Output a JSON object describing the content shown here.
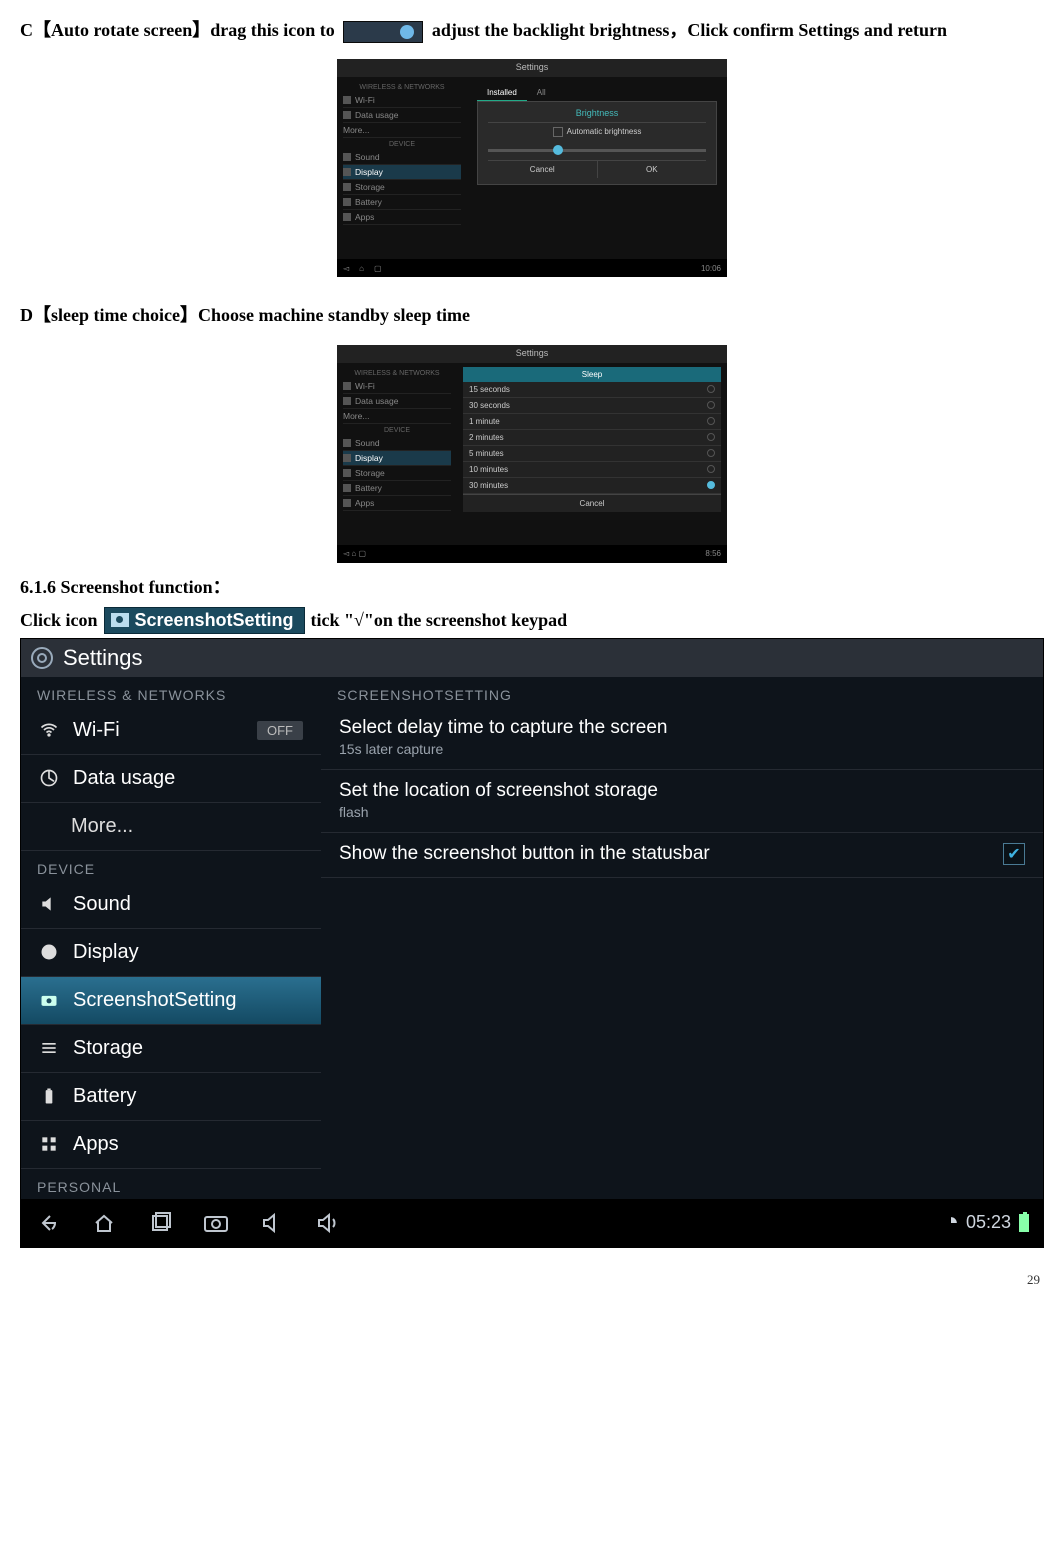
{
  "doc": {
    "line_c_prefix": "C【Auto rotate screen】drag this icon to ",
    "line_c_suffix": "adjust the backlight brightness，Click confirm Settings and return",
    "line_d": "D【sleep time choice】Choose machine standby sleep time",
    "heading_616": "6.1.6 Screenshot function：",
    "clickicon_pre": "Click icon",
    "clickicon_post": " tick \"√\"on the screenshot keypad",
    "page_number": "29"
  },
  "ss_button": {
    "label": "ScreenshotSetting"
  },
  "shot1": {
    "title": "Settings",
    "sect_wireless": "WIRELESS & NETWORKS",
    "sect_device": "DEVICE",
    "side": {
      "wifi": "Wi-Fi",
      "datausage": "Data usage",
      "more": "More...",
      "sound": "Sound",
      "display": "Display",
      "storage": "Storage",
      "battery": "Battery",
      "apps": "Apps"
    },
    "tabs": {
      "installed": "Installed",
      "all": "All"
    },
    "dialog": {
      "title": "Brightness",
      "auto": "Automatic brightness",
      "cancel": "Cancel",
      "ok": "OK"
    },
    "clock": "10:06"
  },
  "shot2": {
    "title": "Settings",
    "sect_wireless": "WIRELESS & NETWORKS",
    "sect_device": "DEVICE",
    "side": {
      "wifi": "Wi-Fi",
      "datausage": "Data usage",
      "more": "More...",
      "sound": "Sound",
      "display": "Display",
      "storage": "Storage",
      "battery": "Battery",
      "apps": "Apps"
    },
    "dialog_title": "Sleep",
    "options": [
      "15 seconds",
      "30 seconds",
      "1 minute",
      "2 minutes",
      "5 minutes",
      "10 minutes",
      "30 minutes"
    ],
    "cancel": "Cancel",
    "clock": "8:56"
  },
  "big": {
    "title": "Settings",
    "cat_wireless": "WIRELESS & NETWORKS",
    "cat_device": "DEVICE",
    "cat_personal": "PERSONAL",
    "left": {
      "wifi": "Wi-Fi",
      "wifi_state": "OFF",
      "datausage": "Data usage",
      "more": "More...",
      "sound": "Sound",
      "display": "Display",
      "screenshot": "ScreenshotSetting",
      "storage": "Storage",
      "battery": "Battery",
      "apps": "Apps"
    },
    "right": {
      "cat": "SCREENSHOTSETTING",
      "delay_title": "Select delay time to capture the screen",
      "delay_sub": "15s later capture",
      "loc_title": "Set the location of screenshot storage",
      "loc_sub": "flash",
      "show_title": "Show the screenshot button in the statusbar"
    },
    "clock": "05:23"
  }
}
